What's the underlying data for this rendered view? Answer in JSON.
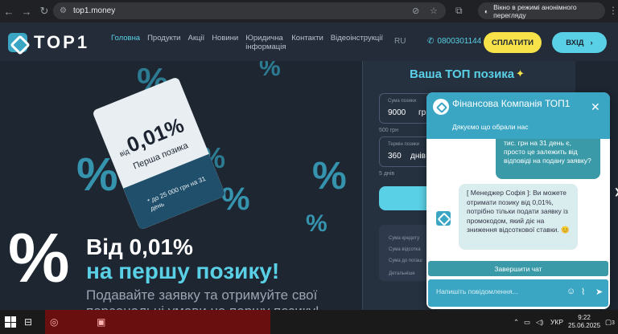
{
  "browser": {
    "url": "top1.money",
    "incognito_label": "Вікно в режимі анонімного перегляду"
  },
  "header": {
    "logo_text": "TOP1",
    "nav": [
      {
        "label": "Головна",
        "active": true
      },
      {
        "label": "Продукти"
      },
      {
        "label": "Акції"
      },
      {
        "label": "Новини"
      },
      {
        "label": "Юридична інформація"
      },
      {
        "label": "Контакти"
      },
      {
        "label": "Відеоінструкції"
      }
    ],
    "lang": "RU",
    "phone": "0800301144",
    "pay_label": "СПЛАТИТИ",
    "login_label": "ВХІД"
  },
  "hero": {
    "ticket_rate": "0,01%",
    "ticket_from": "від",
    "ticket_sub": "Перша позика",
    "ticket_note": "* до 25 000 грн на 31 день",
    "big_symbol": "%",
    "headline_1": "Від 0,01%",
    "headline_2": "на першу позику!",
    "paragraph": "Подавайте заявку та отримуйте свої персональні умови на першу позику!"
  },
  "loan_form": {
    "title": "Ваша ТОП позика",
    "amount_label": "Сума позики",
    "amount_value": "9000",
    "amount_unit": "грн",
    "amount_hint": "500 грн",
    "term_label": "Термін позики",
    "term_value": "360",
    "term_unit": "днів",
    "term_hint": "5 днів",
    "summary_rows": [
      "Сума кредиту",
      "Сума відсотка",
      "Сума до погаш",
      "Детальніше"
    ]
  },
  "chat": {
    "title": "Фінансова Компанія ТОП1",
    "subtitle": "Дякуємо що обрали нас",
    "user_message": "тис. грн на 31 день є, просто це залежить від відповіді на подану заявку?",
    "bot_message": "[ Менеджер Софія ]: Ви можете отримати позику від 0,01%, потрібно тільки подати заявку із промокодом, який діє на зниження відсоткової ставки. 😊",
    "end_chat_label": "Завершити чат",
    "input_placeholder": "Напишіть повідомлення..."
  },
  "taskbar": {
    "lang": "УКР",
    "time": "9:22",
    "date": "25.06.2025",
    "notifications": "3"
  }
}
